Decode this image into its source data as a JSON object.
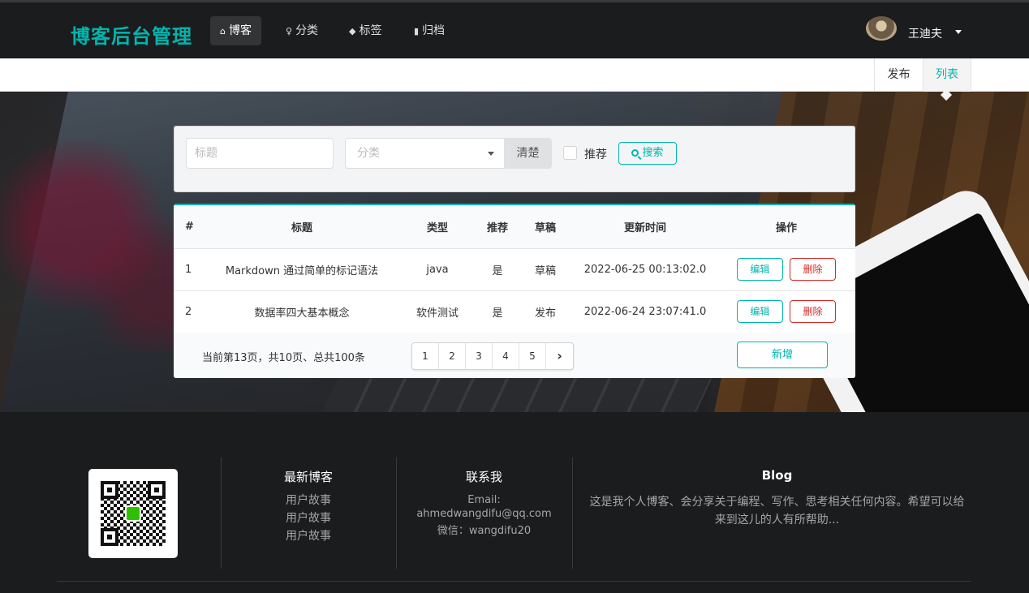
{
  "nav": {
    "brand": "博客后台管理",
    "items": [
      {
        "label": "博客",
        "icon": "home-icon"
      },
      {
        "label": "分类",
        "icon": "idea-icon"
      },
      {
        "label": "标签",
        "icon": "tags-icon"
      },
      {
        "label": "归档",
        "icon": "file-icon"
      }
    ],
    "user_name": "王迪夫"
  },
  "submenu": {
    "publish": "发布",
    "list": "列表"
  },
  "search": {
    "title_placeholder": "标题",
    "category_placeholder": "分类",
    "clear_label": "清楚",
    "recommend_label": "推荐",
    "search_label": "搜索"
  },
  "table": {
    "headers": [
      "#",
      "标题",
      "类型",
      "推荐",
      "草稿",
      "更新时间",
      "操作"
    ],
    "rows": [
      {
        "id": "1",
        "title": "Markdown 通过简单的标记语法",
        "type": "java",
        "recommend": "是",
        "draft": "草稿",
        "updated": "2022-06-25 00:13:02.0",
        "edit": "编辑",
        "delete": "删除"
      },
      {
        "id": "2",
        "title": "数据率四大基本概念",
        "type": "软件测试",
        "recommend": "是",
        "draft": "发布",
        "updated": "2022-06-24 23:07:41.0",
        "edit": "编辑",
        "delete": "删除"
      }
    ],
    "page_info": "当前第13页，共10页、总共100条",
    "pages": [
      "1",
      "2",
      "3",
      "4",
      "5"
    ],
    "add_label": "新增"
  },
  "footer": {
    "latest_title": "最新博客",
    "latest_items": [
      "用户故事",
      "用户故事",
      "用户故事"
    ],
    "contact_title": "联系我",
    "email_label": "Email:",
    "email": "ahmedwangdifu@qq.com",
    "wechat": "微信：wangdifu20",
    "blog_title": "Blog",
    "blog_text": "这是我个人博客、会分享关于编程、写作、思考相关任何内容。希望可以给来到这儿的人有所帮助..."
  },
  "colors": {
    "accent": "#00b5ad",
    "danger": "#db2828",
    "dark": "#1b1c1d"
  }
}
